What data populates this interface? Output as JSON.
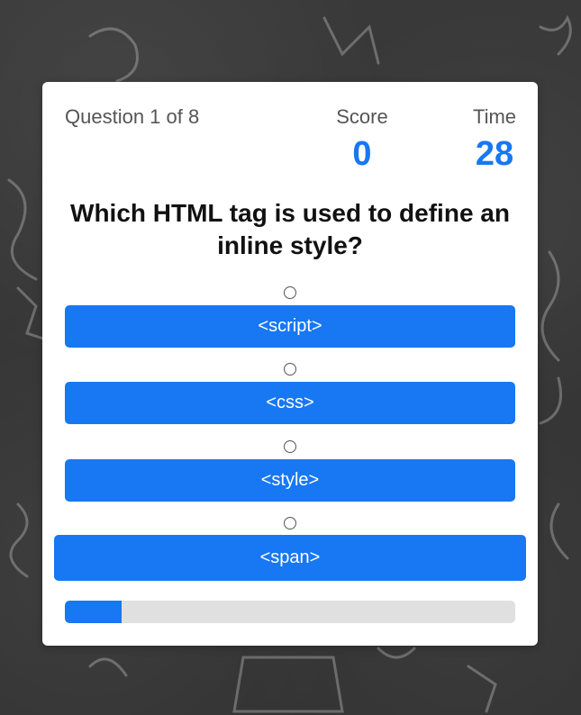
{
  "quiz": {
    "question_counter": "Question 1 of 8",
    "score_label": "Score",
    "score_value": "0",
    "time_label": "Time",
    "time_value": "28",
    "question": "Which HTML tag is used to define an inline style?",
    "options": [
      {
        "label": "<script>"
      },
      {
        "label": "<css>"
      },
      {
        "label": "<style>"
      },
      {
        "label": "<span>"
      }
    ],
    "progress_fraction": 0.125
  },
  "colors": {
    "accent": "#1877f2",
    "background": "#3a3a3a",
    "card": "#ffffff",
    "progress_track": "#e0e0e0"
  }
}
